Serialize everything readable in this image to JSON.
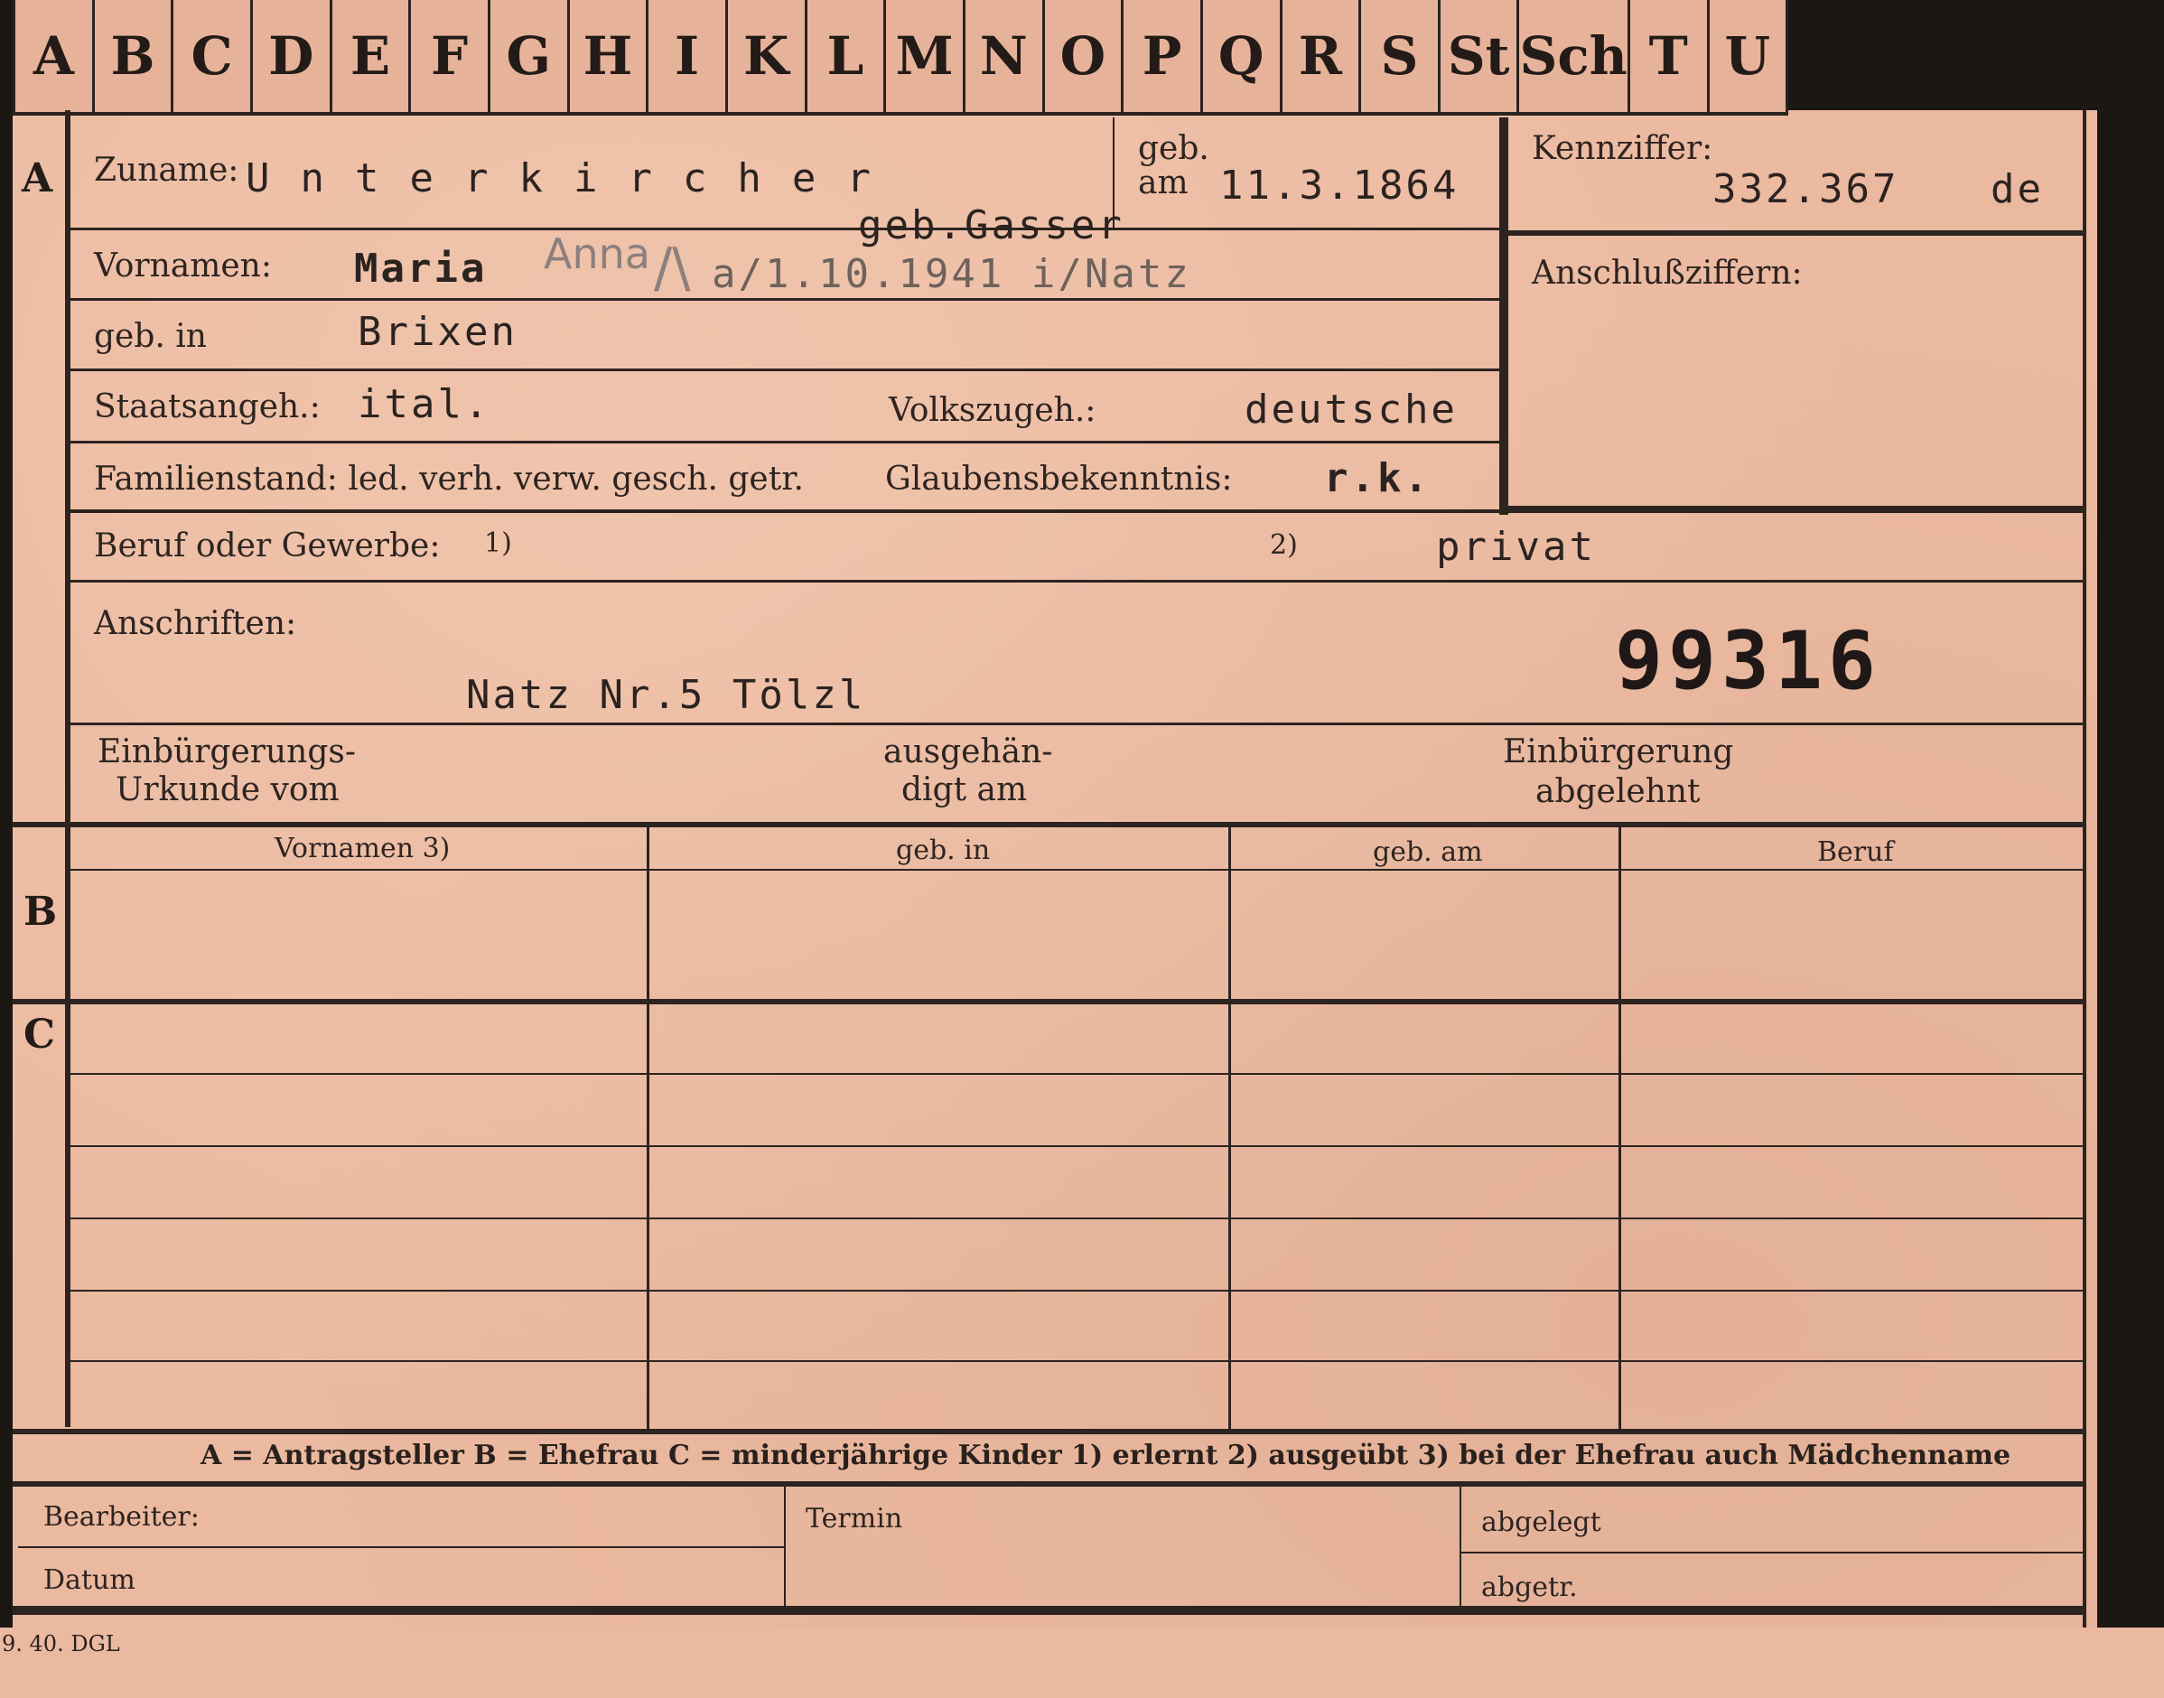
{
  "tabs": [
    "A",
    "B",
    "C",
    "D",
    "E",
    "F",
    "G",
    "H",
    "I",
    "K",
    "L",
    "M",
    "N",
    "O",
    "P",
    "Q",
    "R",
    "S",
    "St",
    "Sch",
    "T",
    "U"
  ],
  "sections": {
    "a": "A",
    "b": "B",
    "c": "C"
  },
  "labels": {
    "zuname": "Zuname:",
    "geb_am": "geb.\nam",
    "kennziffer": "Kennziffer:",
    "anschlussziffern": "Anschlußziffern:",
    "vornamen": "Vornamen:",
    "geb_in": "geb. in",
    "staatsangeh": "Staatsangeh.:",
    "volkszugeh": "Volkszugeh.:",
    "familienstand": "Familienstand: led. verh. verw. gesch. getr.",
    "glaubensbekenntnis": "Glaubensbekenntnis:",
    "beruf_oder_gewerbe": "Beruf oder Gewerbe:",
    "footnote1": "1)",
    "footnote2": "2)",
    "anschriften": "Anschriften:",
    "einbuergerung_urkunde_1": "Einbürgerungs-",
    "einbuergerung_urkunde_2": "Urkunde vom",
    "ausgehaendigt_1": "ausgehän-",
    "ausgehaendigt_2": "digt am",
    "einbuergerung_abgelehnt_1": "Einbürgerung",
    "einbuergerung_abgelehnt_2": "abgelehnt"
  },
  "values": {
    "surname": "Unterkircher",
    "geb_gasser": "geb.Gasser",
    "birth_date": "11.3.1864",
    "kennziffer": "332.367",
    "kennziffer_suffix": "de",
    "first_name": "Maria",
    "first_name_pencil": "Anna",
    "death_note": "a/1.10.1941 i/Natz",
    "birthplace": "Brixen",
    "citizenship": "ital.",
    "ethnicity": "deutsche",
    "religion": "r.k.",
    "occupation2": "privat",
    "address": "Natz Nr.5 Tölzl",
    "case_number": "99316"
  },
  "table": {
    "headers": [
      "Vornamen 3)",
      "geb. in",
      "geb. am",
      "Beruf"
    ]
  },
  "legend": "A = Antragsteller   B = Ehefrau   C = minderjährige Kinder   1) erlernt   2) ausgeübt   3) bei der Ehefrau auch Mädchenname",
  "footer": {
    "bearbeiter": "Bearbeiter:",
    "datum": "Datum",
    "termin": "Termin",
    "abgelegt": "abgelegt",
    "abgetr": "abgetr."
  },
  "print_mark": "9. 40. DGL",
  "colors": {
    "card": "#ebb9a0",
    "ink": "#2c2420",
    "background": "#1b1814"
  }
}
